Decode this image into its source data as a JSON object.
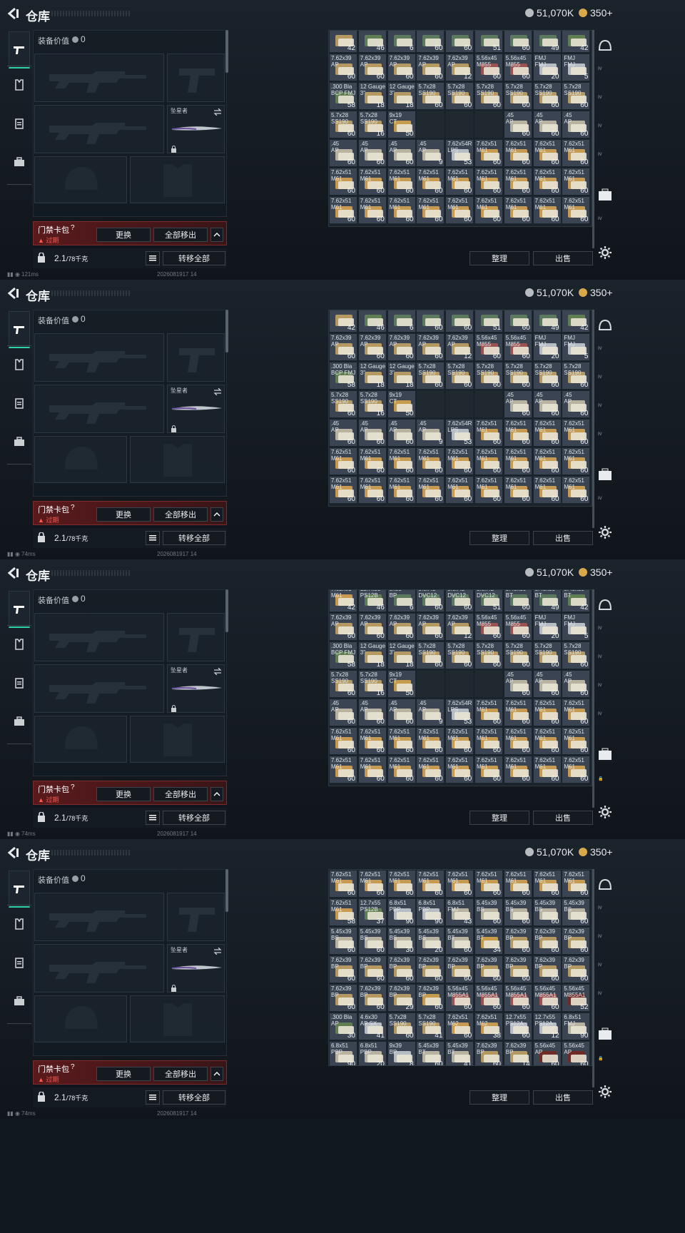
{
  "panels": [
    {
      "first_row_counts": [
        "42",
        "46",
        "6",
        "60",
        "60",
        "51",
        "60",
        "49",
        "42"
      ],
      "grid_offset": 0,
      "latency": "121ms",
      "lock_row": false,
      "variant": "a"
    },
    {
      "first_row_counts": [
        "42",
        "46",
        "6",
        "60",
        "60",
        "51",
        "60",
        "49",
        "42"
      ],
      "grid_offset": 0,
      "latency": "74ms",
      "lock_row": false,
      "variant": "a"
    },
    {
      "first_row_counts": [
        "42",
        "46",
        "6",
        "60",
        "60",
        "51",
        "60",
        "49",
        "42"
      ],
      "grid_offset": 0,
      "latency": "74ms",
      "lock_row": true,
      "variant": "b"
    },
    {
      "first_row_counts": [],
      "grid_offset": 0,
      "latency": "74ms",
      "lock_row": true,
      "variant": "c"
    }
  ],
  "header": {
    "title": "仓库",
    "currency1": "51,070K",
    "currency2": "350+"
  },
  "loadout": {
    "value_label": "装备价值",
    "value": "0",
    "knife_label": "坠星者"
  },
  "card": {
    "name": "门禁卡包",
    "question": "?",
    "status": "过期",
    "replace": "更换",
    "move_all_out": "全部移出"
  },
  "footer": {
    "weight": "2.1",
    "weight_max": "/78千克",
    "transfer_all": "转移全部",
    "sort": "整理",
    "sell": "出售",
    "timestamp": "2026081917 14"
  },
  "colors": {
    "accent": "#2fd1a6",
    "red": "#e0393a",
    "gold": "#c9a458"
  },
  "grids": {
    "a": [
      [
        [
          "",
          "42",
          "t"
        ],
        [
          "",
          "46",
          "g"
        ],
        [
          "",
          "6",
          "gr"
        ],
        [
          "",
          "60",
          "gr"
        ],
        [
          "",
          "60",
          "gr"
        ],
        [
          "",
          "51",
          "gr"
        ],
        [
          "",
          "60",
          "gr"
        ],
        [
          "",
          "49",
          "gr"
        ],
        [
          "",
          "42",
          "g"
        ]
      ],
      [
        [
          "7.62x39\nAP",
          "60",
          "t"
        ],
        [
          "7.62x39\nAP",
          "60",
          "t"
        ],
        [
          "7.62x39\nAP",
          "60",
          "t"
        ],
        [
          "7.62x39\nAP",
          "60",
          "t"
        ],
        [
          "7.62x39\nAP",
          "12",
          "t"
        ],
        [
          "5.56x45\nM855",
          "60",
          "r"
        ],
        [
          "5.56x45\nM855",
          "60",
          "r"
        ],
        [
          "FMJ\nFMJ",
          "20",
          "w"
        ],
        [
          "FMJ\nFMJ",
          "5",
          "w"
        ]
      ],
      [
        [
          ".300 Bla\nBCP FMJ",
          "58",
          "g"
        ],
        [
          "12 Gauge\n3\"",
          "18",
          "t"
        ],
        [
          "12 Gauge\n3\"",
          "18",
          "t"
        ],
        [
          "5.7x28\nSS190",
          "60",
          "t"
        ],
        [
          "5.7x28\nSS190",
          "60",
          "t"
        ],
        [
          "5.7x28\nSS190",
          "60",
          "t"
        ],
        [
          "5.7x28\nSS190",
          "60",
          "t"
        ],
        [
          "5.7x28\nSS190",
          "60",
          "t"
        ],
        [
          "5.7x28\nSS190",
          "60",
          "t"
        ]
      ],
      [
        [
          "5.7x28\nSS190",
          "60",
          "t"
        ],
        [
          "5.7x28\nSS190",
          "16",
          "t"
        ],
        [
          "9x19\nCT",
          "50",
          "gold"
        ],
        null,
        null,
        null,
        [
          ".45\nAP",
          "60",
          "s"
        ],
        [
          ".45\nAP",
          "60",
          "s"
        ],
        [
          ".45\nAP",
          "60",
          "s"
        ]
      ],
      [
        [
          ".45\nAP",
          "60",
          "s"
        ],
        [
          ".45\nAP",
          "60",
          "s"
        ],
        [
          ".45\nAP",
          "60",
          "s"
        ],
        [
          ".45\nAP",
          "9",
          "s"
        ],
        [
          "7.62x54R\nLPS",
          "53",
          "w"
        ],
        [
          "7.62x51\nM61",
          "60",
          "y"
        ],
        [
          "7.62x51\nM61",
          "60",
          "y"
        ],
        [
          "7.62x51\nM61",
          "60",
          "y"
        ],
        [
          "7.62x51\nM61",
          "60",
          "y"
        ]
      ],
      [
        [
          "7.62x51\nM61",
          "60",
          "y"
        ],
        [
          "7.62x51\nM61",
          "60",
          "y"
        ],
        [
          "7.62x51\nM61",
          "60",
          "y"
        ],
        [
          "7.62x51\nM61",
          "60",
          "y"
        ],
        [
          "7.62x51\nM61",
          "60",
          "y"
        ],
        [
          "7.62x51\nM61",
          "60",
          "y"
        ],
        [
          "7.62x51\nM61",
          "60",
          "y"
        ],
        [
          "7.62x51\nM61",
          "60",
          "y"
        ],
        [
          "7.62x51\nM61",
          "60",
          "y"
        ]
      ],
      [
        [
          "7.62x51\nM61",
          "60",
          "y"
        ],
        [
          "7.62x51\nM61",
          "60",
          "y"
        ],
        [
          "7.62x51\nM61",
          "60",
          "y"
        ],
        [
          "7.62x51\nM61",
          "60",
          "y"
        ],
        [
          "7.62x51\nM61",
          "60",
          "y"
        ],
        [
          "7.62x51\nM61",
          "60",
          "y"
        ],
        [
          "7.62x51\nM61",
          "60",
          "y"
        ],
        [
          "7.62x51\nM61",
          "60",
          "y"
        ],
        [
          "7.62x51\nM61",
          "60",
          "y"
        ]
      ]
    ],
    "b": [
      [
        [
          "7.62x51\nM61",
          "42",
          "y"
        ],
        [
          "12.7x55\nPS12B",
          "46",
          "g"
        ],
        [
          "9x39\nBP",
          "6",
          "gr"
        ],
        [
          "5.8x42\nDVC12",
          "60",
          "gr"
        ],
        [
          "5.8x42\nDVC12",
          "60",
          "gr"
        ],
        [
          "5.8x42\nDVC12",
          "51",
          "gr"
        ],
        [
          "5.45x39\nBT",
          "60",
          "gr"
        ],
        [
          "5.45x39\nBT",
          "49",
          "gr"
        ],
        [
          "5.45x39\nBT",
          "42",
          "g"
        ]
      ],
      [
        [
          "7.62x39\nAP",
          "60",
          "t"
        ],
        [
          "7.62x39\nAP",
          "60",
          "t"
        ],
        [
          "7.62x39\nAP",
          "60",
          "t"
        ],
        [
          "7.62x39\nAP",
          "60",
          "t"
        ],
        [
          "7.62x39\nAP",
          "12",
          "t"
        ],
        [
          "5.56x45\nM855",
          "60",
          "r"
        ],
        [
          "5.56x45\nM855",
          "60",
          "r"
        ],
        [
          "FMJ\nFMJ",
          "20",
          "w"
        ],
        [
          "FMJ\nFMJ",
          "5",
          "w"
        ]
      ],
      [
        [
          ".300 Bla\nBCP FMJ",
          "58",
          "g"
        ],
        [
          "12 Gauge\n3\"",
          "18",
          "t"
        ],
        [
          "12 Gauge\n3\"",
          "18",
          "t"
        ],
        [
          "5.7x28\nSS190",
          "60",
          "t"
        ],
        [
          "5.7x28\nSS190",
          "60",
          "t"
        ],
        [
          "5.7x28\nSS190",
          "60",
          "t"
        ],
        [
          "5.7x28\nSS190",
          "60",
          "t"
        ],
        [
          "5.7x28\nSS190",
          "60",
          "t"
        ],
        [
          "5.7x28\nSS190",
          "60",
          "t"
        ]
      ],
      [
        [
          "5.7x28\nSS190",
          "60",
          "t"
        ],
        [
          "5.7x28\nSS190",
          "16",
          "t"
        ],
        [
          "9x19\nCT",
          "50",
          "gold"
        ],
        null,
        null,
        null,
        [
          ".45\nAP",
          "60",
          "s"
        ],
        [
          ".45\nAP",
          "60",
          "s"
        ],
        [
          ".45\nAP",
          "60",
          "s"
        ]
      ],
      [
        [
          ".45\nAP",
          "60",
          "s"
        ],
        [
          ".45\nAP",
          "60",
          "s"
        ],
        [
          ".45\nAP",
          "60",
          "s"
        ],
        [
          ".45\nAP",
          "9",
          "s"
        ],
        [
          "7.62x54R\nLPS",
          "53",
          "w"
        ],
        [
          "7.62x51\nM61",
          "60",
          "y"
        ],
        [
          "7.62x51\nM61",
          "60",
          "y"
        ],
        [
          "7.62x51\nM61",
          "60",
          "y"
        ],
        [
          "7.62x51\nM61",
          "60",
          "y"
        ]
      ],
      [
        [
          "7.62x51\nM61",
          "60",
          "y"
        ],
        [
          "7.62x51\nM61",
          "60",
          "y"
        ],
        [
          "7.62x51\nM61",
          "60",
          "y"
        ],
        [
          "7.62x51\nM61",
          "60",
          "y"
        ],
        [
          "7.62x51\nM61",
          "60",
          "y"
        ],
        [
          "7.62x51\nM61",
          "60",
          "y"
        ],
        [
          "7.62x51\nM61",
          "60",
          "y"
        ],
        [
          "7.62x51\nM61",
          "60",
          "y"
        ],
        [
          "7.62x51\nM61",
          "60",
          "y"
        ]
      ],
      [
        [
          "7.62x51\nM61",
          "60",
          "y"
        ],
        [
          "7.62x51\nM61",
          "60",
          "y"
        ],
        [
          "7.62x51\nM61",
          "60",
          "y"
        ],
        [
          "7.62x51\nM61",
          "60",
          "y"
        ],
        [
          "7.62x51\nM61",
          "60",
          "y"
        ],
        [
          "7.62x51\nM61",
          "60",
          "y"
        ],
        [
          "7.62x51\nM61",
          "60",
          "y"
        ],
        [
          "7.62x51\nM61",
          "60",
          "y"
        ],
        [
          "7.62x51\nM61",
          "60",
          "y"
        ]
      ]
    ],
    "c": [
      [
        [
          "7.62x51\nM61",
          "60",
          "y"
        ],
        [
          "7.62x51\nM61",
          "60",
          "y"
        ],
        [
          "7.62x51\nM61",
          "60",
          "y"
        ],
        [
          "7.62x51\nM61",
          "60",
          "y"
        ],
        [
          "7.62x51\nM61",
          "60",
          "y"
        ],
        [
          "7.62x51\nM61",
          "60",
          "y"
        ],
        [
          "7.62x51\nM61",
          "60",
          "y"
        ],
        [
          "7.62x51\nM61",
          "60",
          "y"
        ],
        [
          "7.62x51\nM61",
          "60",
          "y"
        ]
      ],
      [
        [
          "7.62x51\nM61",
          "58",
          "y"
        ],
        [
          "12.7x55\nPS12B",
          "37",
          "g"
        ],
        [
          "6.8x51\nPBP",
          "90",
          "w"
        ],
        [
          "6.8x51\nPBP",
          "90",
          "w"
        ],
        [
          "6.8x51\nFMJ",
          "43",
          "s"
        ],
        [
          "5.45x39\nBS",
          "60",
          "s"
        ],
        [
          "5.45x39\nBS",
          "60",
          "s"
        ],
        [
          "5.45x39\nBS",
          "60",
          "s"
        ],
        [
          "5.45x39\nBS",
          "60",
          "s"
        ]
      ],
      [
        [
          "5.45x39\nBS",
          "60",
          "s"
        ],
        [
          "5.45x39\nBS",
          "60",
          "s"
        ],
        [
          "5.45x39\nBS",
          "30",
          "s"
        ],
        [
          "5.45x39\nBS",
          "20",
          "s"
        ],
        [
          "5.45x39\nBT",
          "60",
          "s"
        ],
        [
          "5.45x39\nBT",
          "34",
          "gold"
        ],
        [
          "7.62x39\nBP",
          "60",
          "t"
        ],
        [
          "7.62x39\nBP",
          "60",
          "t"
        ],
        [
          "7.62x39\nBP",
          "60",
          "t"
        ]
      ],
      [
        [
          "7.62x39\nBP",
          "60",
          "t"
        ],
        [
          "7.62x39\nBP",
          "60",
          "t"
        ],
        [
          "7.62x39\nBP",
          "60",
          "t"
        ],
        [
          "7.62x39\nBP",
          "60",
          "t"
        ],
        [
          "7.62x39\nBP",
          "60",
          "t"
        ],
        [
          "7.62x39\nBP",
          "60",
          "t"
        ],
        [
          "7.62x39\nBP",
          "60",
          "t"
        ],
        [
          "7.62x39\nBP",
          "60",
          "t"
        ],
        [
          "7.62x39\nBP",
          "60",
          "t"
        ]
      ],
      [
        [
          "7.62x39\nBP",
          "60",
          "t"
        ],
        [
          "7.62x39\nBP",
          "60",
          "t"
        ],
        [
          "7.62x39\nBP",
          "29",
          "t"
        ],
        [
          "7.62x39\nBP",
          "60",
          "gold"
        ],
        [
          "5.56x45\nM855A1",
          "60",
          "r"
        ],
        [
          "5.56x45\nM855A1",
          "60",
          "r"
        ],
        [
          "5.56x45\nM855A1",
          "60",
          "r"
        ],
        [
          "5.56x45\nM855A1",
          "60",
          "r"
        ],
        [
          "5.56x45\nM855A1",
          "52",
          "dr"
        ]
      ],
      [
        [
          ".300 Bla\nAP",
          "30",
          "g"
        ],
        [
          "4.6x30\nAP SX",
          "41",
          "w"
        ],
        [
          "5.7x28\nSS190",
          "60",
          "t"
        ],
        [
          "5.7x28\nSS190",
          "41",
          "t"
        ],
        [
          "7.62x51\nM62",
          "60",
          "y"
        ],
        [
          "7.62x51\nM62",
          "38",
          "y"
        ],
        [
          "12.7x55\nPS12A",
          "60",
          "w"
        ],
        [
          "12.7x55\nPS12A",
          "12",
          "w"
        ],
        [
          "6.8x51\nFMJ",
          "90",
          "s"
        ]
      ],
      [
        [
          "6.8x51\nPBP",
          "90",
          "s"
        ],
        [
          "6.8x51\nPBP",
          "20",
          "s"
        ],
        [
          "9x39\nBP",
          "8",
          "w"
        ],
        [
          "5.45x39\nBT",
          "60",
          "s"
        ],
        [
          "5.45x39\nBT",
          "41",
          "s"
        ],
        [
          "7.62x39\nBP",
          "60",
          "t"
        ],
        [
          "7.62x39\nBP",
          "14",
          "t"
        ],
        [
          "5.56x45\nAP",
          "60",
          "dr"
        ],
        [
          "5.56x45\nAP",
          "60",
          "dr"
        ]
      ],
      [
        [
          "5.56x45\nAP",
          "",
          "dr"
        ],
        [
          "5.56x45\nAP",
          "",
          "dr"
        ],
        [
          "5.56x45\nAP",
          "",
          "dr"
        ],
        [
          "5.56x45\nAP",
          "",
          "dr"
        ]
      ]
    ]
  }
}
